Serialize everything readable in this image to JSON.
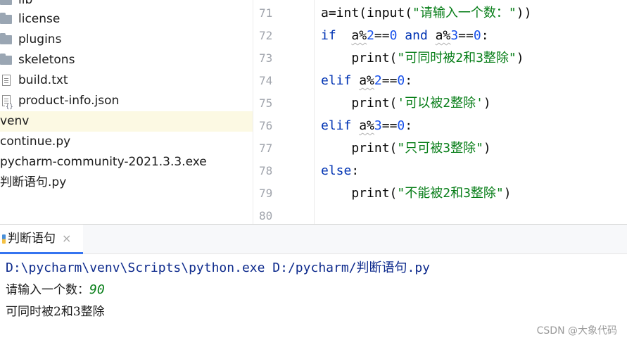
{
  "project_tree": {
    "items": [
      {
        "label": "lib",
        "icon": "folder-icon",
        "type": "folder"
      },
      {
        "label": "license",
        "icon": "folder-icon",
        "type": "folder"
      },
      {
        "label": "plugins",
        "icon": "folder-icon",
        "type": "folder"
      },
      {
        "label": "skeletons",
        "icon": "folder-icon",
        "type": "folder"
      },
      {
        "label": "build.txt",
        "icon": "text-file-icon",
        "type": "file"
      },
      {
        "label": "product-info.json",
        "icon": "json-file-icon",
        "type": "file"
      },
      {
        "label": "venv",
        "type": "folder",
        "selected": true
      },
      {
        "label": "continue.py",
        "type": "file"
      },
      {
        "label": "pycharm-community-2021.3.3.exe",
        "type": "file"
      },
      {
        "label": "判断语句.py",
        "type": "file"
      }
    ]
  },
  "editor": {
    "line_numbers": [
      "71",
      "72",
      "73",
      "74",
      "75",
      "76",
      "77",
      "78",
      "79",
      "80"
    ],
    "code_lines": [
      "a=int(input(\"请输入一个数：\"))",
      "if  a%2==0 and a%3==0:",
      "    print(\"可同时被2和3整除\")",
      "elif a%2==0:",
      "    print('可以被2整除')",
      "elif a%3==0:",
      "    print(\"只可被3整除\")",
      "else:",
      "    print(\"不能被2和3整除\")",
      ""
    ]
  },
  "run_panel": {
    "tab_label": "判断语句",
    "close_glyph": "×",
    "command": "D:\\pycharm\\venv\\Scripts\\python.exe D:/pycharm/判断语句.py",
    "prompt": "请输入一个数：",
    "user_input": "90",
    "output": "可同时被2和3整除"
  },
  "watermark": "CSDN @大象代码",
  "colors": {
    "keyword": "#0033b3",
    "number": "#1750eb",
    "string": "#067d17",
    "selected_row": "#fcf9e3",
    "active_tab_underline": "#3574f0"
  }
}
